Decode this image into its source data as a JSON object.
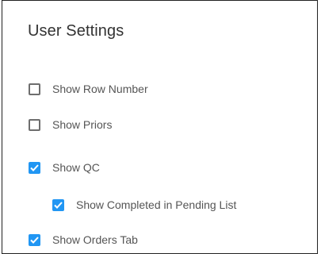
{
  "settings": {
    "title": "User Settings",
    "accent_color": "#2196f3",
    "options": [
      {
        "label": "Show Row Number",
        "checked": false,
        "indent": 0
      },
      {
        "label": "Show Priors",
        "checked": false,
        "indent": 0
      },
      {
        "label": "Show QC",
        "checked": true,
        "indent": 0
      },
      {
        "label": "Show Completed in Pending List",
        "checked": true,
        "indent": 1
      },
      {
        "label": "Show Orders Tab",
        "checked": true,
        "indent": 0
      }
    ]
  }
}
